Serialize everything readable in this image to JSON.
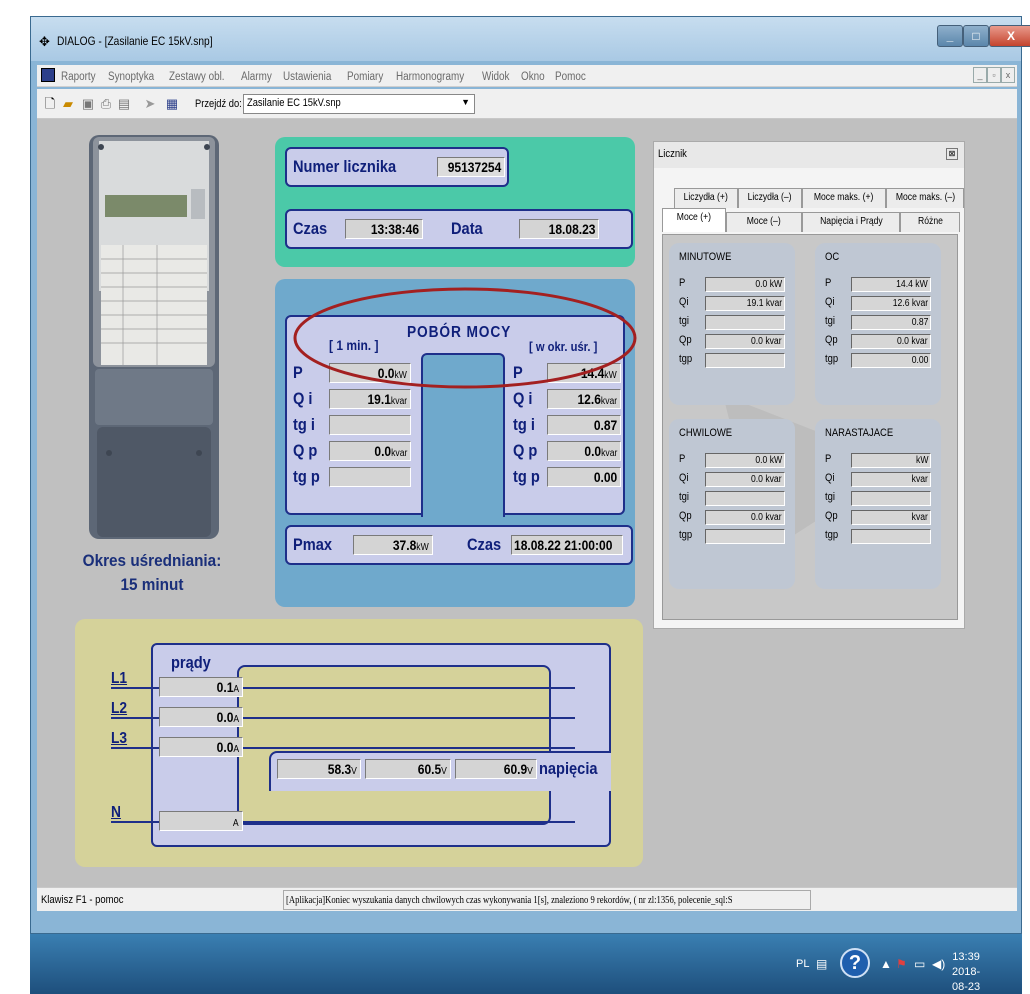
{
  "window": {
    "title": "DIALOG - [Zasilanie EC 15kV.snp]",
    "min_label": "_",
    "max_label": "□",
    "close_label": "X"
  },
  "menu": [
    "Raporty",
    "Synoptyka",
    "Zestawy obl.",
    "Alarmy",
    "Ustawienia",
    "Pomiary",
    "Harmonogramy",
    "Widok",
    "Okno",
    "Pomoc"
  ],
  "toolbar": {
    "goto_label": "Przejdź do:",
    "goto_value": "Zasilanie EC 15kV.snp"
  },
  "meter_panel": {
    "okres_label": "Okres uśredniania:",
    "okres_value": "15 minut"
  },
  "header": {
    "numer_label": "Numer licznika",
    "numer_value": "95137254",
    "czas_label": "Czas",
    "czas_value": "13:38:46",
    "data_label": "Data",
    "data_value": "18.08.23"
  },
  "pobor": {
    "title": "POBÓR MOCY",
    "left_label": "[ 1 min. ]",
    "right_label": "[ w okr. uśr. ]",
    "rows": [
      {
        "label": "P",
        "left": "0.0",
        "left_unit": "kW",
        "right": "14.4",
        "right_unit": "kW"
      },
      {
        "label": "Q i",
        "left": "19.1",
        "left_unit": "kvar",
        "right": "12.6",
        "right_unit": "kvar"
      },
      {
        "label": "tg i",
        "left": "",
        "left_unit": "",
        "right": "0.87",
        "right_unit": ""
      },
      {
        "label": "Q p",
        "left": "0.0",
        "left_unit": "kvar",
        "right": "0.0",
        "right_unit": "kvar"
      },
      {
        "label": "tg p",
        "left": "",
        "left_unit": "",
        "right": "0.00",
        "right_unit": ""
      }
    ],
    "pmax_label": "Pmax",
    "pmax_value": "37.8",
    "pmax_unit": "kW",
    "czas_label": "Czas",
    "czas_value": "18.08.22 21:00:00"
  },
  "prady": {
    "title": "prądy",
    "phases": [
      {
        "label": "L1",
        "value": "0.1",
        "unit": "A"
      },
      {
        "label": "L2",
        "value": "0.0",
        "unit": "A"
      },
      {
        "label": "L3",
        "value": "0.0",
        "unit": "A"
      },
      {
        "label": "N",
        "value": "",
        "unit": "A"
      }
    ],
    "napiecia_label": "napięcia",
    "napiecia": [
      {
        "value": "58.3",
        "unit": "V"
      },
      {
        "value": "60.5",
        "unit": "V"
      },
      {
        "value": "60.9",
        "unit": "V"
      }
    ]
  },
  "licznik": {
    "title": "Licznik",
    "tabs_row1": [
      "Liczydła (+)",
      "Liczydła (–)",
      "Moce maks. (+)",
      "Moce maks. (–)"
    ],
    "tabs_row2": [
      "Moce (+)",
      "Moce (–)",
      "Napięcia i Prądy",
      "Różne"
    ],
    "groups": [
      {
        "title": "MINUTOWE",
        "rows": [
          {
            "label": "P",
            "value": "0.0 kW"
          },
          {
            "label": "Qi",
            "value": "19.1 kvar"
          },
          {
            "label": "tgi",
            "value": ""
          },
          {
            "label": "Qp",
            "value": "0.0 kvar"
          },
          {
            "label": "tgp",
            "value": ""
          }
        ]
      },
      {
        "title": "OC",
        "rows": [
          {
            "label": "P",
            "value": "14.4 kW"
          },
          {
            "label": "Qi",
            "value": "12.6 kvar"
          },
          {
            "label": "tgi",
            "value": "0.87"
          },
          {
            "label": "Qp",
            "value": "0.0 kvar"
          },
          {
            "label": "tgp",
            "value": "0.00"
          }
        ]
      },
      {
        "title": "CHWILOWE",
        "rows": [
          {
            "label": "P",
            "value": "0.0 kW"
          },
          {
            "label": "Qi",
            "value": "0.0 kvar"
          },
          {
            "label": "tgi",
            "value": ""
          },
          {
            "label": "Qp",
            "value": "0.0 kvar"
          },
          {
            "label": "tgp",
            "value": ""
          }
        ]
      },
      {
        "title": "NARASTAJACE",
        "rows": [
          {
            "label": "P",
            "value": "kW"
          },
          {
            "label": "Qi",
            "value": "kvar"
          },
          {
            "label": "tgi",
            "value": ""
          },
          {
            "label": "Qp",
            "value": "kvar"
          },
          {
            "label": "tgp",
            "value": ""
          }
        ]
      }
    ]
  },
  "status": {
    "left": "Klawisz F1 - pomoc",
    "right": "[Aplikacja]Koniec wyszukania danych chwilowych czas wykonywania  1[s], znaleziono 9 rekordów, ( nr zl:1356, polecenie_sql:S"
  },
  "taskbar": {
    "lang": "PL",
    "time": "13:39",
    "date": "2018-08-23"
  },
  "colors": {
    "highlight_ellipse": "#a32020",
    "navy": "#0f1f7a"
  }
}
